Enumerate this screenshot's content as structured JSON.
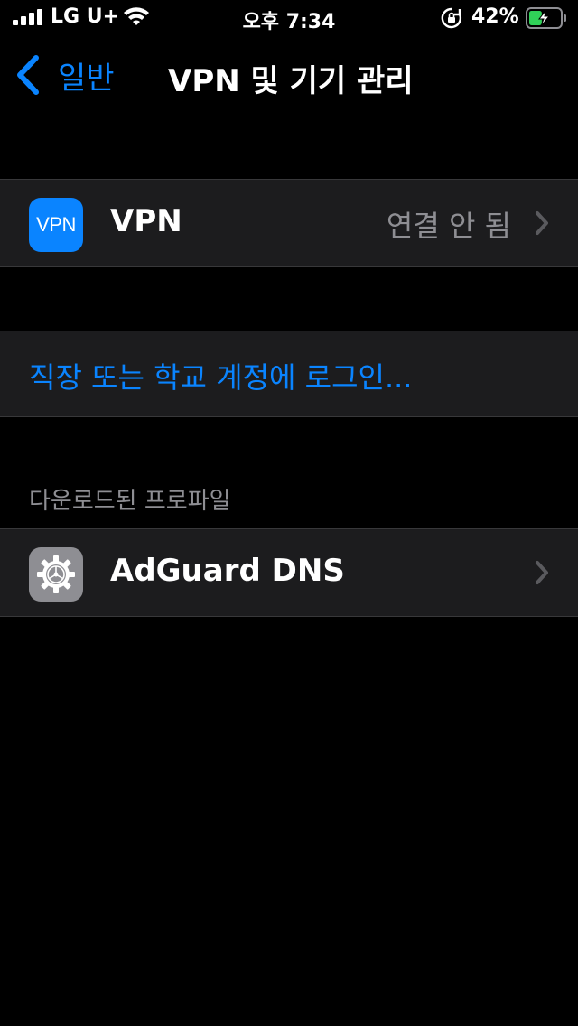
{
  "status_bar": {
    "carrier": "LG U+",
    "time": "오후 7:34",
    "battery_percent": "42%",
    "battery_level": 0.42
  },
  "nav": {
    "back_label": "일반",
    "title": "VPN 및 기기 관리"
  },
  "vpn_row": {
    "icon_text": "VPN",
    "label": "VPN",
    "value": "연결 안 됨"
  },
  "account_row": {
    "label": "직장 또는 학교 계정에 로그인..."
  },
  "profiles_section": {
    "header": "다운로드된 프로파일",
    "items": [
      {
        "label": "AdGuard DNS"
      }
    ]
  },
  "colors": {
    "accent": "#0a84ff",
    "background": "#000000",
    "cell": "#1c1c1e",
    "secondary_text": "#8e8e93",
    "battery_charging": "#30d158"
  }
}
